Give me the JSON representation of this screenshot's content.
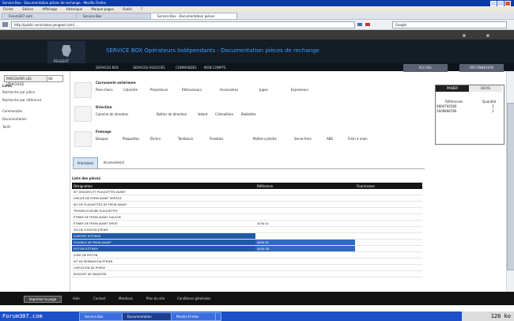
{
  "window": {
    "title": "Service Box - Documentation pièces de rechange - Mozilla Firefox"
  },
  "menu": [
    "Fichier",
    "Edition",
    "Affichage",
    "Historique",
    "Marque-pages",
    "Outils",
    "?"
  ],
  "tabs": [
    {
      "label": "Forum307.com"
    },
    {
      "label": "Service Box"
    },
    {
      "label": "Service Box - Documentation pièces"
    }
  ],
  "address": {
    "url": "http://public.servicebox.peugeot.com/..."
  },
  "search": {
    "placeholder": "Google"
  },
  "header": {
    "brand": "PEUGEOT",
    "title": "SERVICE BOX Opérateurs Indépendants - Documentation pièces de rechange",
    "nav": [
      "SERVICES BOX",
      "SERVICES ASSOCIÉS",
      "COMMANDES",
      "MON COMPTE"
    ],
    "buttons": [
      "ACCUEIL",
      "DÉCONNEXION"
    ]
  },
  "left": {
    "select": "PARCOURIR LES VÉHICULES",
    "go": "OK",
    "heading": "Liens",
    "items": [
      "Recherche par pièce",
      "Recherche par référence",
      "Commandes",
      "Documentation",
      "Tarifs"
    ]
  },
  "catalog": [
    {
      "heading": "Carrosserie extérieure",
      "items": [
        "Pare-chocs",
        "Calandre",
        "Projecteurs",
        "Rétroviseurs",
        "Accessoires",
        "Jupes",
        "Enjoliveurs"
      ]
    },
    {
      "heading": "Direction",
      "items": [
        "Colonne de direction",
        "Boîtier de direction",
        "Volant",
        "Crémaillère",
        "Biellettes"
      ]
    },
    {
      "heading": "Freinage",
      "items": [
        "Disques",
        "Plaquettes",
        "Étriers",
        "Tambours",
        "Flexibles",
        "Maître-cylindre",
        "Servo-frein",
        "ABS",
        "Frein à main"
      ]
    }
  ],
  "right_panel": {
    "tabs": [
      "PANIER",
      "DEVIS"
    ],
    "rows": [
      {
        "label": "Références",
        "value": "Quantité"
      },
      {
        "label": "9800700580",
        "value": "1"
      },
      {
        "label": "1609898780",
        "value": "1"
      }
    ]
  },
  "subtabs": {
    "active": "Précédent",
    "other": "Accessoire(s)"
  },
  "table": {
    "caption": "Liste des pièces",
    "headers": [
      "Désignation",
      "Référence",
      "Fournisseur"
    ],
    "rows": [
      [
        "KIT DISQUES ET PLAQUETTES AVANT",
        "",
        ""
      ],
      [
        "DISQUE DE FREIN AVANT VENTILÉ",
        "",
        ""
      ],
      [
        "JEU DE PLAQUETTES DE FREIN AVANT",
        "",
        ""
      ],
      [
        "TÉMOIN D'USURE PLAQUETTES",
        "",
        ""
      ],
      [
        "ÉTRIER DE FREIN AVANT GAUCHE",
        "",
        ""
      ],
      [
        "ÉTRIER DE FREIN AVANT DROIT",
        "4254 42",
        ""
      ],
      [
        "VIS DE FIXATION ÉTRIER",
        "",
        ""
      ],
      [
        "SUPPORT D'ÉTRIER",
        "",
        ""
      ],
      [
        "FLEXIBLE DE FREIN AVANT",
        "4806 85",
        ""
      ],
      [
        "PISTON D'ÉTRIER",
        "4400 G6",
        ""
      ],
      [
        "JOINT DE PISTON",
        "",
        ""
      ],
      [
        "KIT DE RÉPARATION ÉTRIER",
        "",
        ""
      ],
      [
        "CAPUCHON DE PURGE",
        "",
        ""
      ],
      [
        "RESSORT DE MAINTIEN",
        "",
        ""
      ]
    ]
  },
  "footer": {
    "button": "Imprimer la page",
    "links": [
      "Aide",
      "Contact",
      "Mentions",
      "Plan du site",
      "Conditions générales"
    ]
  },
  "taskbar": {
    "forum": "Forum307.com",
    "tasks": [
      "Service Box",
      "Documentation",
      "Mozilla Firefox",
      "Service Box"
    ],
    "size": "126 ko"
  }
}
